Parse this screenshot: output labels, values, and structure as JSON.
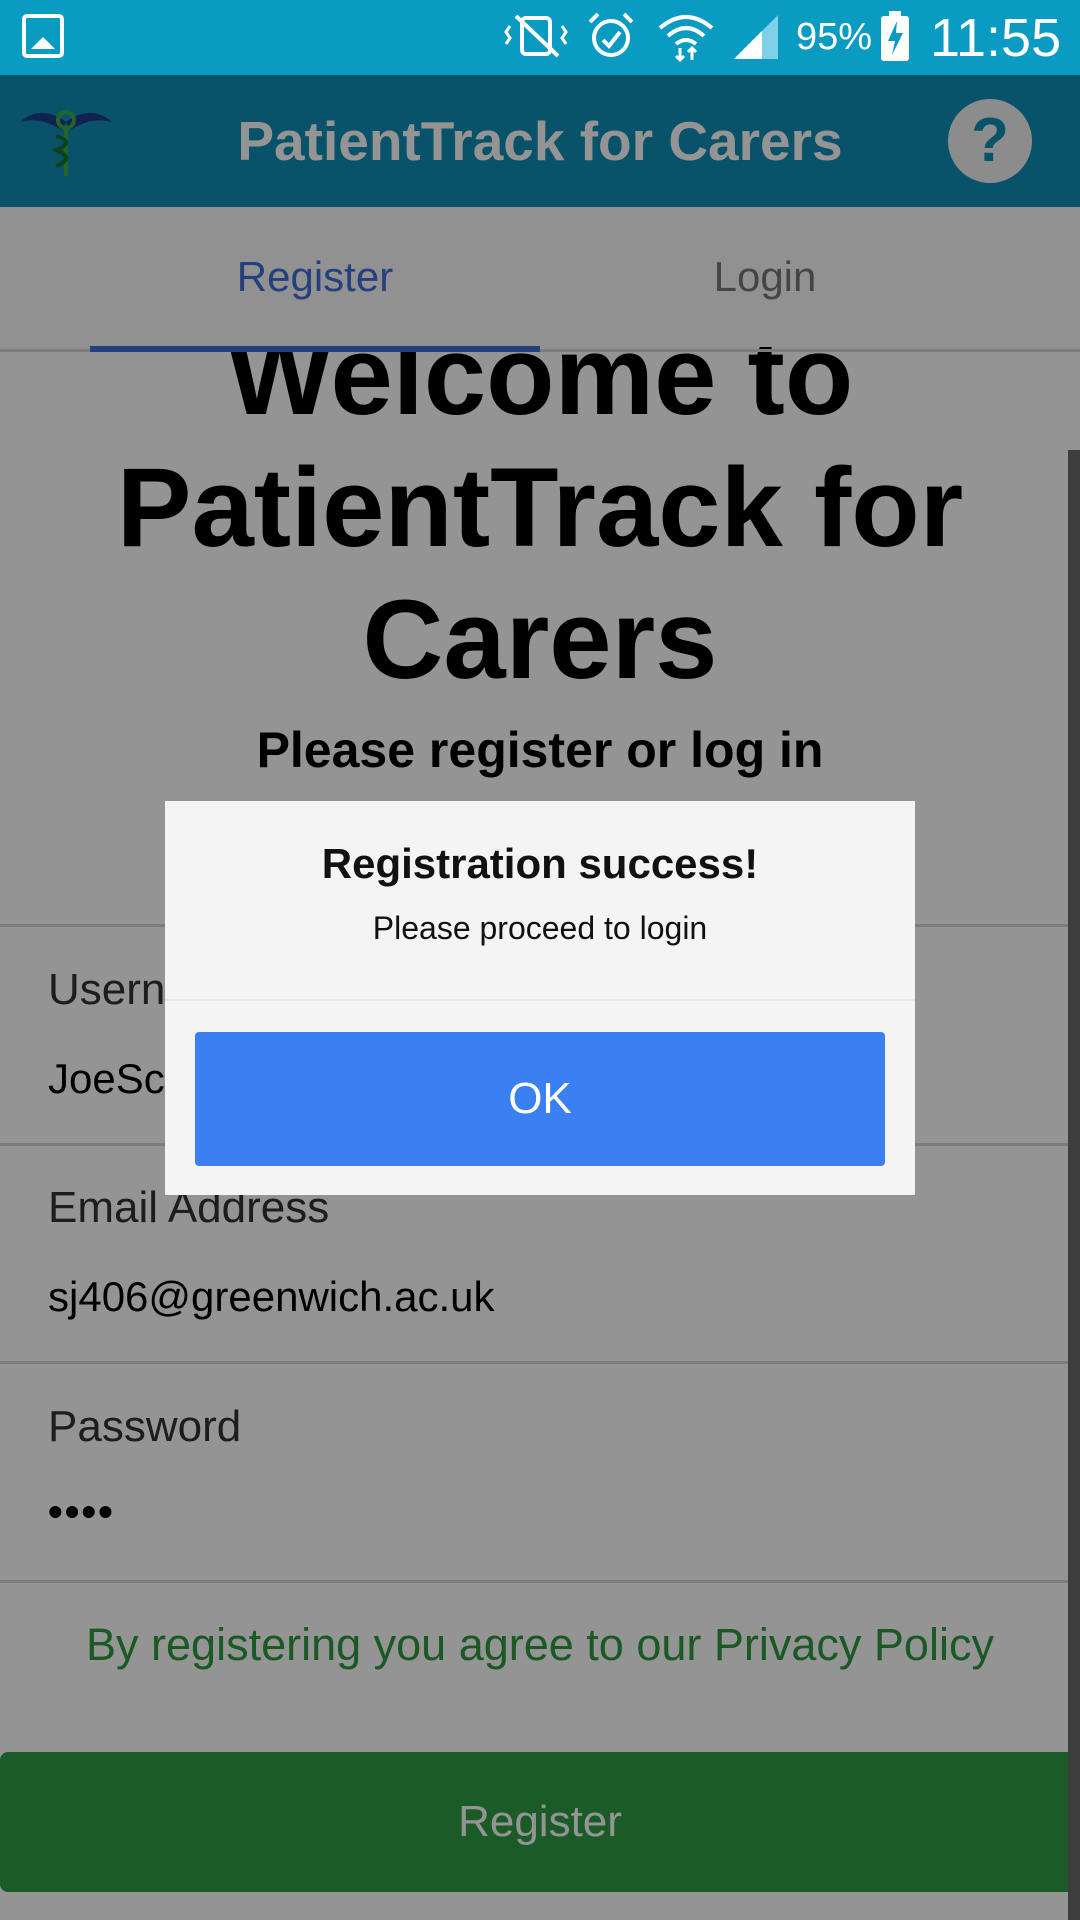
{
  "status_bar": {
    "battery": "95%",
    "time": "11:55",
    "icons": [
      "gallery-icon",
      "vibrate-mute-icon",
      "alarm-icon",
      "wifi-icon",
      "signal-icon",
      "battery-charging-icon"
    ]
  },
  "app_bar": {
    "title": "PatientTrack for Carers",
    "help_label": "?",
    "logo_icon": "caduceus-logo-icon"
  },
  "tabs": [
    {
      "label": "Register",
      "active": true
    },
    {
      "label": "Login",
      "active": false
    }
  ],
  "main": {
    "welcome_lines": [
      "Welcome to",
      "PatientTrack for",
      "Carers"
    ],
    "subtitle": "Please register or log in",
    "fields": [
      {
        "label": "Username",
        "value": "JoeSchmoe"
      },
      {
        "label": "Email Address",
        "value": "sj406@greenwich.ac.uk"
      },
      {
        "label": "Password",
        "value": "••••"
      }
    ],
    "privacy_text": "By registering you agree to our Privacy Policy",
    "register_button": "Register"
  },
  "dialog": {
    "title": "Registration success!",
    "message": "Please proceed to login",
    "ok_label": "OK"
  },
  "colors": {
    "status_bar": "#0a9bc3",
    "app_bar": "#0e90b6",
    "tab_active": "#3f6ed8",
    "privacy_green": "#2e9a3e",
    "register_green": "#2f9e44",
    "ok_blue": "#3b80f3"
  }
}
